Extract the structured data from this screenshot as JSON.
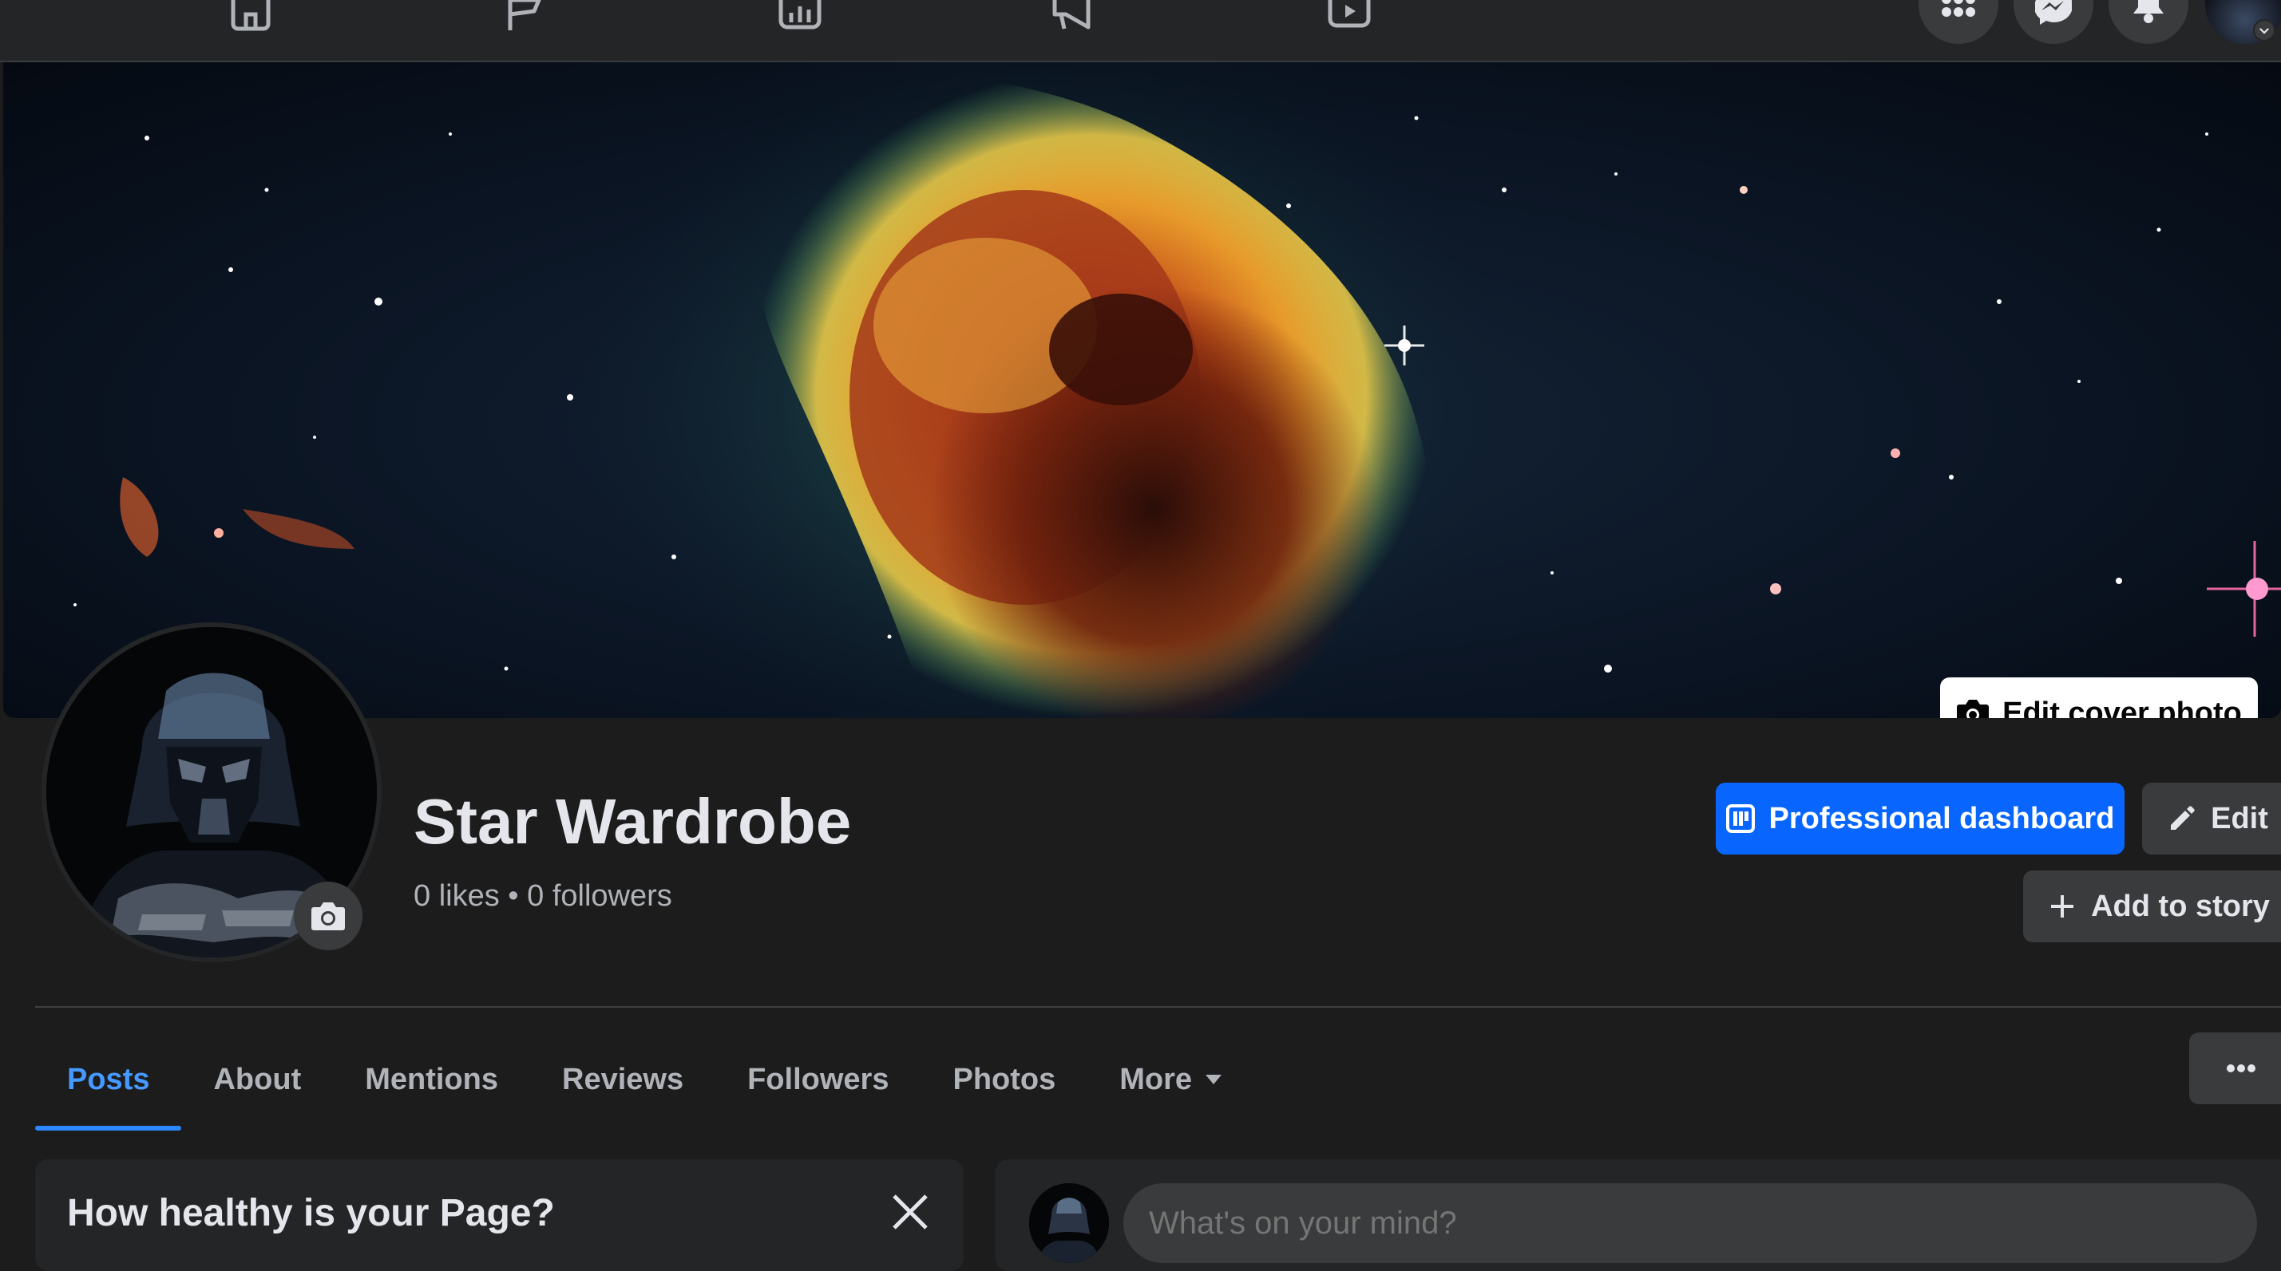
{
  "nav": {
    "icons": [
      "home-icon",
      "flag-icon",
      "insights-icon",
      "megaphone-icon",
      "video-icon"
    ],
    "right_icons": [
      "grid-menu-icon",
      "messenger-icon",
      "bell-icon"
    ]
  },
  "cover": {
    "edit_label": "Edit cover photo"
  },
  "page": {
    "name": "Star Wardrobe",
    "likes": "0 likes",
    "separator": " • ",
    "followers": "0 followers"
  },
  "actions": {
    "dashboard_label": "Professional dashboard",
    "edit_label": "Edit",
    "story_label": "Add to story"
  },
  "tabs": [
    {
      "label": "Posts",
      "active": true
    },
    {
      "label": "About"
    },
    {
      "label": "Mentions"
    },
    {
      "label": "Reviews"
    },
    {
      "label": "Followers"
    },
    {
      "label": "Photos"
    },
    {
      "label": "More"
    }
  ],
  "health_card": {
    "title": "How healthy is your Page?"
  },
  "composer": {
    "placeholder": "What's on your mind?"
  },
  "colors": {
    "accent": "#0866ff",
    "tab_active": "#4599ff",
    "background": "#1c1c1d",
    "surface": "#242526"
  }
}
